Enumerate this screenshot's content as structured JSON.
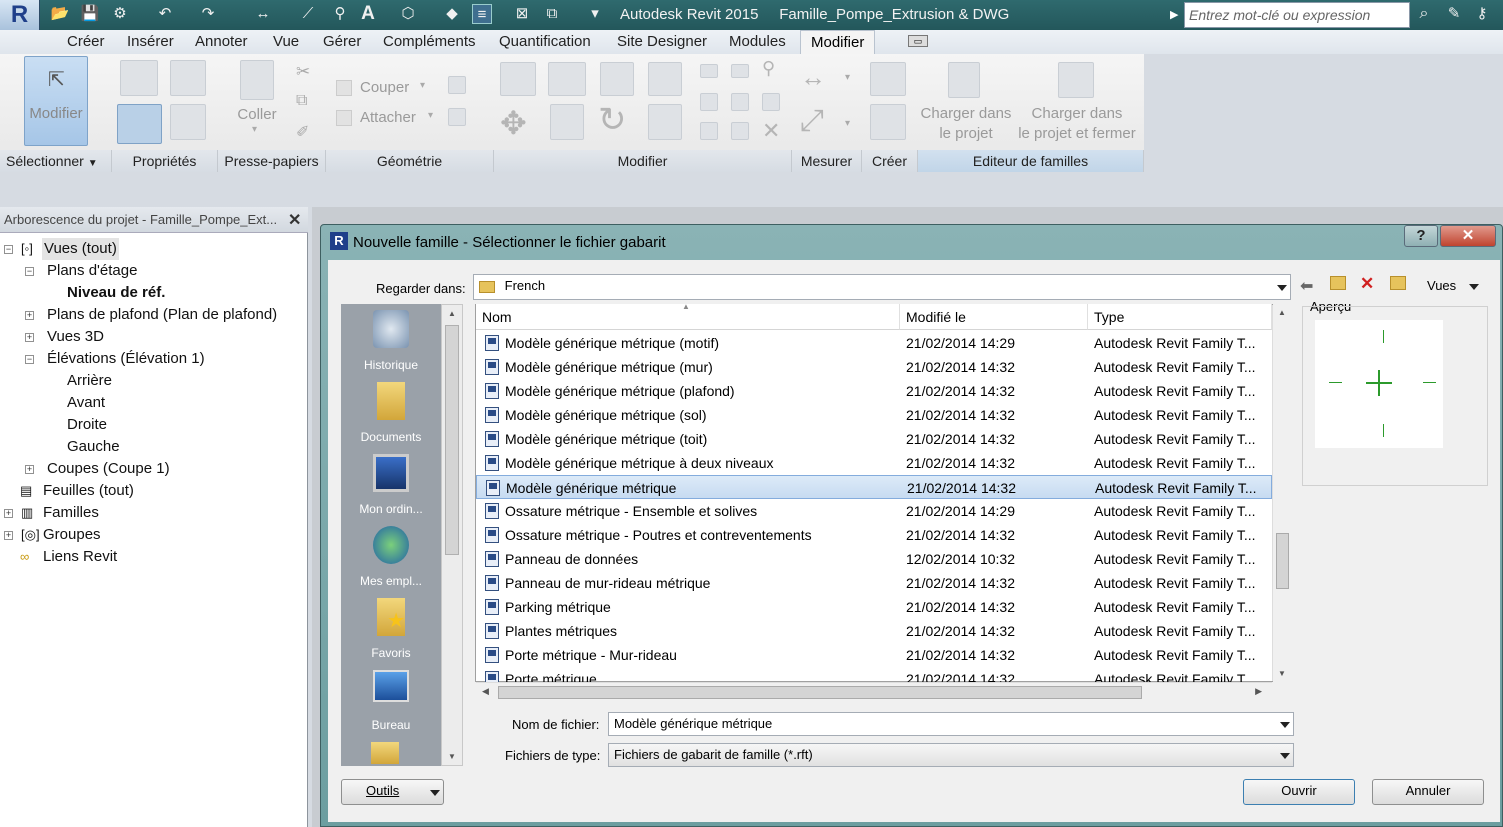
{
  "app": {
    "title": "Autodesk Revit 2015     Famille_Pompe_Extrusion & DWG",
    "logo": "R",
    "search_placeholder": "Entrez mot-clé ou expression"
  },
  "menu": {
    "tabs": [
      "Créer",
      "Insérer",
      "Annoter",
      "Vue",
      "Gérer",
      "Compléments",
      "Quantification",
      "Site Designer",
      "Modules"
    ],
    "active": "Modifier"
  },
  "ribbon": {
    "modifier_label": "Modifier",
    "coller_label": "Coller",
    "couper_label": "Couper",
    "attacher_label": "Attacher",
    "charger_projet": [
      "Charger dans",
      "le projet"
    ],
    "charger_fermer": [
      "Charger dans",
      "le projet et fermer"
    ],
    "panels": {
      "selectionner": "Sélectionner",
      "proprietes": "Propriétés",
      "presse_papiers": "Presse-papiers",
      "geometrie": "Géométrie",
      "modifier": "Modifier",
      "mesurer": "Mesurer",
      "creer": "Créer",
      "editeur": "Editeur de familles"
    }
  },
  "project_browser": {
    "title": "Arborescence du projet - Famille_Pompe_Ext...",
    "items": [
      "Vues (tout)",
      "Plans d'étage",
      "Niveau de réf.",
      "Plans de plafond (Plan de plafond)",
      "Vues 3D",
      "Élévations (Élévation 1)",
      "Arrière",
      "Avant",
      "Droite",
      "Gauche",
      "Coupes (Coupe 1)",
      "Feuilles (tout)",
      "Familles",
      "Groupes",
      "Liens Revit"
    ]
  },
  "dialog": {
    "title": "Nouvelle famille - Sélectionner le fichier gabarit",
    "look_in_label": "Regarder dans:",
    "look_in_value": "French",
    "views_label": "Vues",
    "preview_label": "Aperçu",
    "places": [
      "Historique",
      "Documents",
      "Mon ordin...",
      "Mes empl...",
      "Favoris",
      "Bureau"
    ],
    "columns": [
      "Nom",
      "Modifié le",
      "Type"
    ],
    "files": [
      {
        "name": "Modèle générique métrique (motif)",
        "date": "21/02/2014 14:29",
        "type": "Autodesk Revit Family T..."
      },
      {
        "name": "Modèle générique métrique (mur)",
        "date": "21/02/2014 14:32",
        "type": "Autodesk Revit Family T..."
      },
      {
        "name": "Modèle générique métrique (plafond)",
        "date": "21/02/2014 14:32",
        "type": "Autodesk Revit Family T..."
      },
      {
        "name": "Modèle générique métrique (sol)",
        "date": "21/02/2014 14:32",
        "type": "Autodesk Revit Family T..."
      },
      {
        "name": "Modèle générique métrique (toit)",
        "date": "21/02/2014 14:32",
        "type": "Autodesk Revit Family T..."
      },
      {
        "name": "Modèle générique métrique à deux niveaux",
        "date": "21/02/2014 14:32",
        "type": "Autodesk Revit Family T..."
      },
      {
        "name": "Modèle générique métrique",
        "date": "21/02/2014 14:32",
        "type": "Autodesk Revit Family T..."
      },
      {
        "name": "Ossature métrique - Ensemble et solives",
        "date": "21/02/2014 14:29",
        "type": "Autodesk Revit Family T..."
      },
      {
        "name": "Ossature métrique - Poutres et contreventements",
        "date": "21/02/2014 14:32",
        "type": "Autodesk Revit Family T..."
      },
      {
        "name": "Panneau de données",
        "date": "12/02/2014 10:32",
        "type": "Autodesk Revit Family T..."
      },
      {
        "name": "Panneau de mur-rideau métrique",
        "date": "21/02/2014 14:32",
        "type": "Autodesk Revit Family T..."
      },
      {
        "name": "Parking métrique",
        "date": "21/02/2014 14:32",
        "type": "Autodesk Revit Family T..."
      },
      {
        "name": "Plantes métriques",
        "date": "21/02/2014 14:32",
        "type": "Autodesk Revit Family T..."
      },
      {
        "name": "Porte métrique - Mur-rideau",
        "date": "21/02/2014 14:32",
        "type": "Autodesk Revit Family T..."
      },
      {
        "name": "Porte métrique",
        "date": "21/02/2014 14:32",
        "type": "Autodesk Revit Family T..."
      }
    ],
    "selected_file": "Modèle générique métrique",
    "filename_label": "Nom de fichier:",
    "filename_value": "Modèle générique métrique",
    "filetype_label": "Fichiers de type:",
    "filetype_value": "Fichiers de gabarit de famille  (*.rft)",
    "tools_label": "Outils",
    "open_label": "Ouvrir",
    "cancel_label": "Annuler"
  }
}
